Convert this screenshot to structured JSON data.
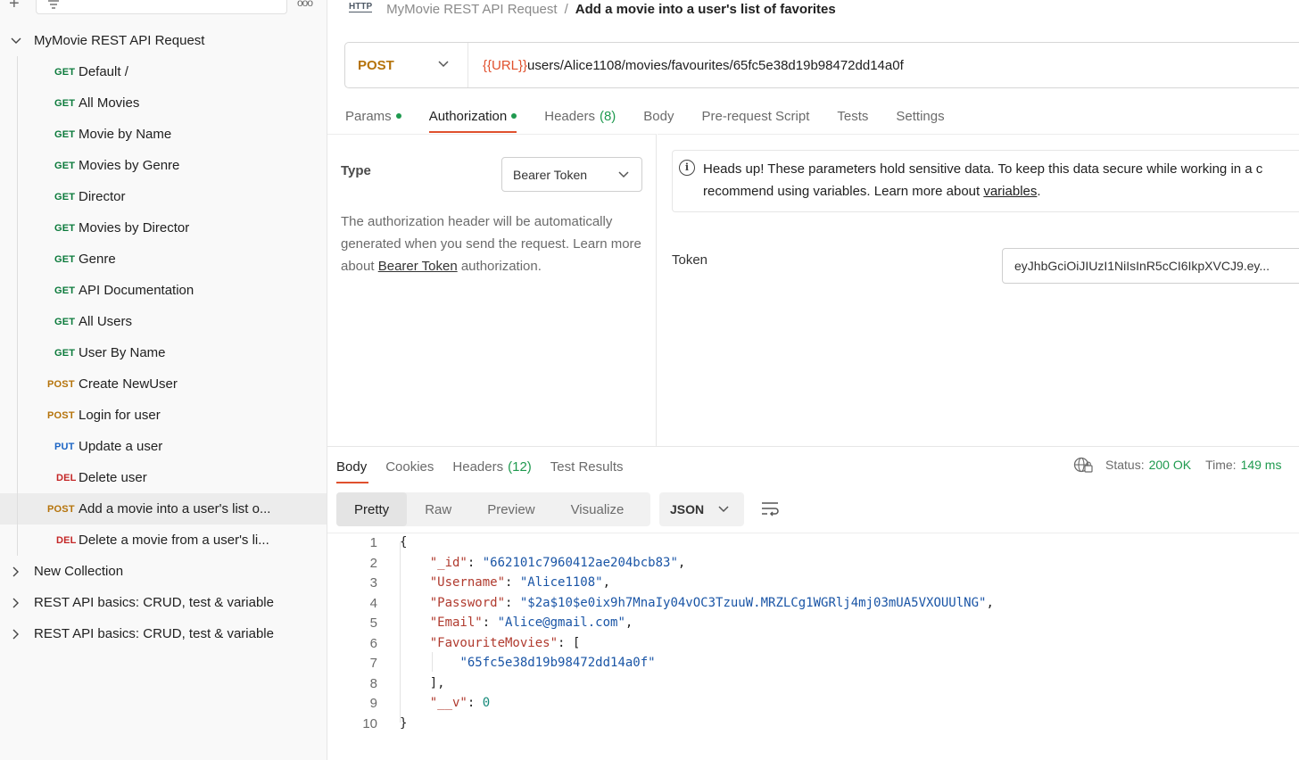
{
  "sidebar": {
    "collections": [
      {
        "label": "MyMovie REST API Request",
        "expanded": true,
        "requests": [
          {
            "method": "GET",
            "label": "Default /"
          },
          {
            "method": "GET",
            "label": "All Movies"
          },
          {
            "method": "GET",
            "label": "Movie by Name"
          },
          {
            "method": "GET",
            "label": "Movies by Genre"
          },
          {
            "method": "GET",
            "label": "Director"
          },
          {
            "method": "GET",
            "label": "Movies by Director"
          },
          {
            "method": "GET",
            "label": "Genre"
          },
          {
            "method": "GET",
            "label": "API Documentation"
          },
          {
            "method": "GET",
            "label": "All Users"
          },
          {
            "method": "GET",
            "label": "User By Name"
          },
          {
            "method": "POST",
            "label": "Create NewUser"
          },
          {
            "method": "POST",
            "label": "Login for user"
          },
          {
            "method": "PUT",
            "label": "Update a user"
          },
          {
            "method": "DEL",
            "label": "Delete user"
          },
          {
            "method": "POST",
            "label": "Add a movie into a user's list o...",
            "selected": true
          },
          {
            "method": "DEL",
            "label": "Delete a movie from a user's li..."
          }
        ]
      },
      {
        "label": "New Collection",
        "expanded": false
      },
      {
        "label": "REST API basics: CRUD, test & variable",
        "expanded": false
      },
      {
        "label": "REST API basics: CRUD, test & variable",
        "expanded": false
      }
    ]
  },
  "breadcrumb": {
    "icon_label": "HTTP",
    "parent": "MyMovie REST API Request",
    "separator": "/",
    "current": "Add a movie into a user's list of favorites"
  },
  "request": {
    "method": "POST",
    "url_variable": "{{URL}}",
    "url_path": "users/Alice1108/movies/favourites/65fc5e38d19b98472dd14a0f"
  },
  "request_tabs": [
    {
      "label": "Params",
      "dot": true
    },
    {
      "label": "Authorization",
      "dot": true,
      "active": true
    },
    {
      "label": "Headers",
      "count": "(8)"
    },
    {
      "label": "Body"
    },
    {
      "label": "Pre-request Script"
    },
    {
      "label": "Tests"
    },
    {
      "label": "Settings"
    }
  ],
  "auth": {
    "type_label": "Type",
    "type_value": "Bearer Token",
    "desc_before": "The authorization header will be automatically generated when you send the request. Learn more about ",
    "desc_link": "Bearer Token",
    "desc_after": " authorization.",
    "notice_line1": "Heads up! These parameters hold sensitive data. To keep this data secure while working in a c",
    "notice_line2_before": "recommend using variables. Learn more about ",
    "notice_link": "variables",
    "notice_line2_after": ".",
    "token_label": "Token",
    "token_value": "eyJhbGciOiJIUzI1NiIsInR5cCI6IkpXVCJ9.ey..."
  },
  "response": {
    "tabs": [
      {
        "label": "Body",
        "active": true
      },
      {
        "label": "Cookies"
      },
      {
        "label": "Headers",
        "count": "(12)"
      },
      {
        "label": "Test Results"
      }
    ],
    "status_label": "Status:",
    "status_value": "200 OK",
    "time_label": "Time:",
    "time_value": "149 ms",
    "formats": [
      "Pretty",
      "Raw",
      "Preview",
      "Visualize"
    ],
    "active_format": "Pretty",
    "language": "JSON",
    "body_lines": [
      {
        "n": "1",
        "text": "{"
      },
      {
        "n": "2",
        "key": "\"_id\"",
        "value": "\"662101c7960412ae204bcb83\"",
        "tail": ",",
        "indent": 1
      },
      {
        "n": "3",
        "key": "\"Username\"",
        "value": "\"Alice1108\"",
        "tail": ",",
        "indent": 1
      },
      {
        "n": "4",
        "key": "\"Password\"",
        "value": "\"$2a$10$e0ix9h7MnaIy04vOC3TzuuW.MRZLCg1WGRlj4mj03mUA5VXOUUlNG\"",
        "tail": ",",
        "indent": 1
      },
      {
        "n": "5",
        "key": "\"Email\"",
        "value": "\"Alice@gmail.com\"",
        "tail": ",",
        "indent": 1
      },
      {
        "n": "6",
        "key": "\"FavouriteMovies\"",
        "value": "[",
        "indent": 1
      },
      {
        "n": "7",
        "value": "\"65fc5e38d19b98472dd14a0f\"",
        "indent": 2
      },
      {
        "n": "8",
        "text": "],",
        "indent": 1
      },
      {
        "n": "9",
        "key": "\"__v\"",
        "number": "0",
        "indent": 1
      },
      {
        "n": "10",
        "text": "}"
      }
    ]
  },
  "colors": {
    "accent": "#e0502d",
    "get": "#0b7a3b",
    "post": "#b5730a",
    "put": "#1b64c4",
    "del": "#c42727",
    "success": "#1f9a4f"
  }
}
